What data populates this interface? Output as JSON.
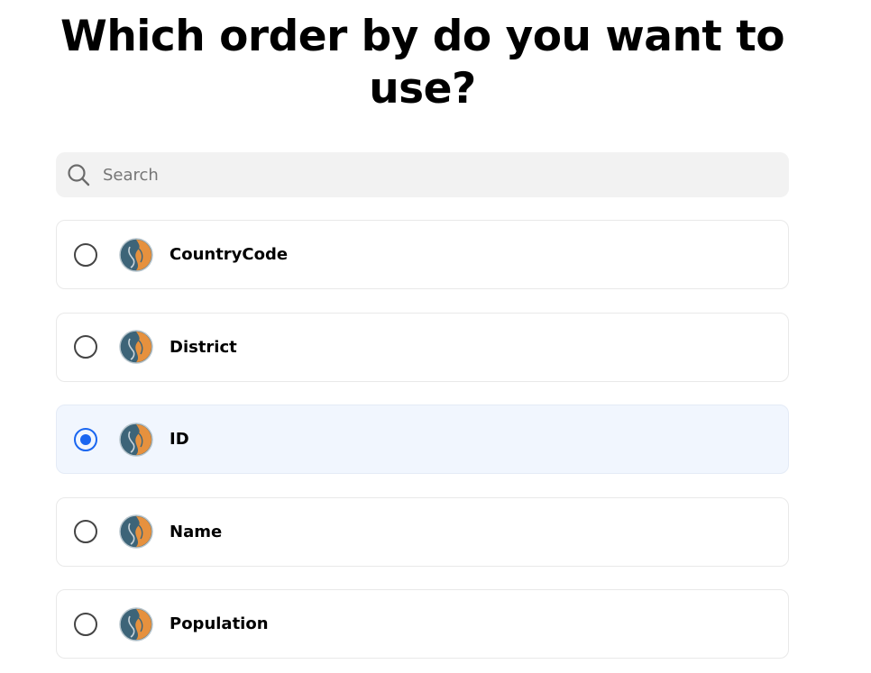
{
  "heading": "Which order by do you want to use?",
  "search": {
    "placeholder": "Search",
    "value": "",
    "icon": "search-icon"
  },
  "options": [
    {
      "label": "CountryCode",
      "selected": false,
      "icon": "database-logo-icon"
    },
    {
      "label": "District",
      "selected": false,
      "icon": "database-logo-icon"
    },
    {
      "label": "ID",
      "selected": true,
      "icon": "database-logo-icon"
    },
    {
      "label": "Name",
      "selected": false,
      "icon": "database-logo-icon"
    },
    {
      "label": "Population",
      "selected": false,
      "icon": "database-logo-icon"
    }
  ],
  "colors": {
    "accent": "#1a66f0",
    "selected_bg": "#f1f6fe",
    "search_bg": "#f2f2f2",
    "logo_dark": "#3d6478",
    "logo_orange": "#e6913e"
  }
}
